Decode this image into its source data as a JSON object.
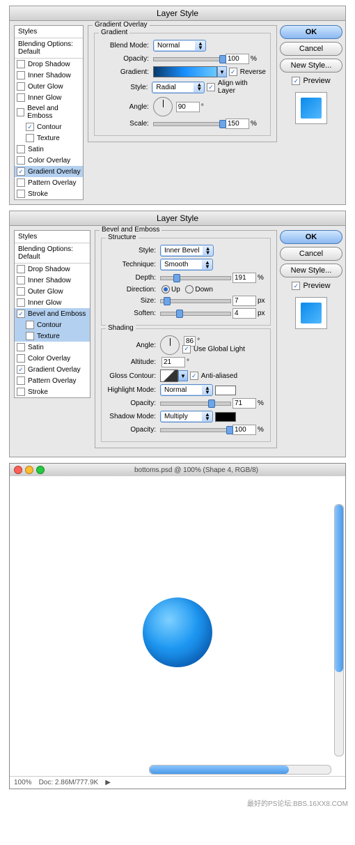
{
  "dlg1": {
    "title": "Layer Style",
    "styles_header": "Styles",
    "blending": "Blending Options: Default",
    "items": [
      "Drop Shadow",
      "Inner Shadow",
      "Outer Glow",
      "Inner Glow",
      "Bevel and Emboss",
      "Contour",
      "Texture",
      "Satin",
      "Color Overlay",
      "Gradient Overlay",
      "Pattern Overlay",
      "Stroke"
    ],
    "section": "Gradient Overlay",
    "sub": "Gradient",
    "blend_mode_lbl": "Blend Mode:",
    "blend_mode": "Normal",
    "opacity_lbl": "Opacity:",
    "opacity": "100",
    "gradient_lbl": "Gradient:",
    "reverse_lbl": "Reverse",
    "style_lbl": "Style:",
    "style": "Radial",
    "align_lbl": "Align with Layer",
    "angle_lbl": "Angle:",
    "angle": "90",
    "scale_lbl": "Scale:",
    "scale": "150",
    "pct": "%",
    "deg": "°"
  },
  "dlg2": {
    "title": "Layer Style",
    "section": "Bevel and Emboss",
    "structure": "Structure",
    "style_lbl": "Style:",
    "style": "Inner Bevel",
    "tech_lbl": "Technique:",
    "tech": "Smooth",
    "depth_lbl": "Depth:",
    "depth": "191",
    "dir_lbl": "Direction:",
    "up": "Up",
    "down": "Down",
    "size_lbl": "Size:",
    "size": "7",
    "soften_lbl": "Soften:",
    "soften": "4",
    "px": "px",
    "shading": "Shading",
    "angle_lbl": "Angle:",
    "angle": "86",
    "use_global": "Use Global Light",
    "alt_lbl": "Altitude:",
    "alt": "21",
    "gloss_lbl": "Gloss Contour:",
    "aa_lbl": "Anti-aliased",
    "hl_lbl": "Highlight Mode:",
    "hl": "Normal",
    "hl_color": "#ffffff",
    "hl_op": "71",
    "sh_lbl": "Shadow Mode:",
    "sh": "Multiply",
    "sh_color": "#000000",
    "sh_op": "100",
    "opacity_lbl": "Opacity:",
    "pct": "%",
    "deg": "°"
  },
  "buttons": {
    "ok": "OK",
    "cancel": "Cancel",
    "newstyle": "New Style...",
    "preview": "Preview"
  },
  "doc": {
    "title": "bottoms.psd @ 100% (Shape 4, RGB/8)",
    "zoom": "100%",
    "docinfo": "Doc: 2.86M/777.9K"
  },
  "watermark": "最好的PS论坛:BBS.16XX8.COM"
}
